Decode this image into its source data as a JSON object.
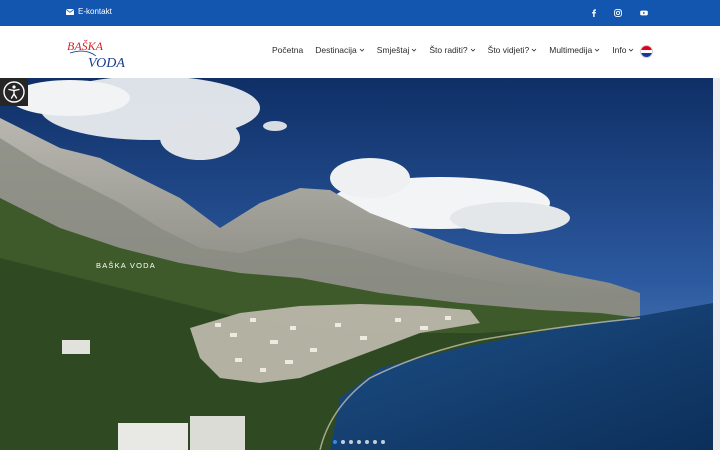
{
  "topbar": {
    "contact_label": "E-kontakt",
    "background": "#1256b0",
    "social": [
      "facebook-icon",
      "instagram-icon",
      "youtube-icon"
    ]
  },
  "header": {
    "logo_text_top": "BAŠKA",
    "logo_text_bottom": "VODA",
    "nav": [
      {
        "label": "Početna",
        "dropdown": false
      },
      {
        "label": "Destinacija",
        "dropdown": true
      },
      {
        "label": "Smještaj",
        "dropdown": true
      },
      {
        "label": "Što raditi?",
        "dropdown": true
      },
      {
        "label": "Što vidjeti?",
        "dropdown": true
      },
      {
        "label": "Multimedija",
        "dropdown": true
      },
      {
        "label": "Info",
        "dropdown": true
      }
    ],
    "language_flag": "croatia-flag-icon"
  },
  "hero": {
    "caption": "BAŠKA VODA",
    "slides": 7,
    "active_slide": 1,
    "accent_color": "#2f8de4"
  },
  "accessibility": {
    "icon": "accessibility-icon"
  }
}
